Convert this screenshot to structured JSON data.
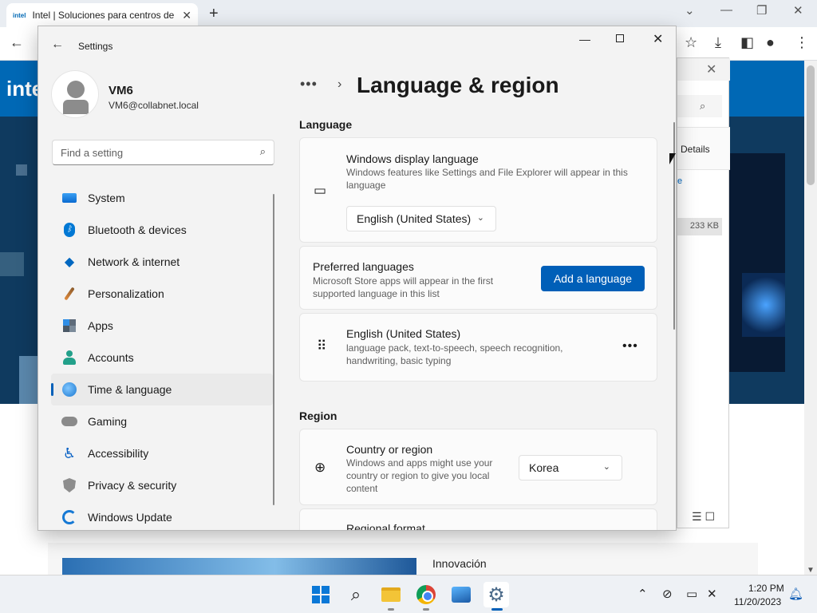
{
  "browser": {
    "tab_title": "Intel | Soluciones para centros de",
    "tab_favicon": "intel",
    "new_tab": "+",
    "intel_logo": "intel"
  },
  "page": {
    "bottom_text": "Innovación"
  },
  "explorer": {
    "details_label": "Details",
    "link_fragment": "e",
    "file_size": "233 KB"
  },
  "settings": {
    "window_title": "Settings",
    "user": {
      "name": "VM6",
      "email": "VM6@collabnet.local"
    },
    "search_placeholder": "Find a setting",
    "nav": [
      {
        "label": "System",
        "icon": "system-icon"
      },
      {
        "label": "Bluetooth & devices",
        "icon": "bluetooth-icon"
      },
      {
        "label": "Network & internet",
        "icon": "wifi-icon"
      },
      {
        "label": "Personalization",
        "icon": "brush-icon"
      },
      {
        "label": "Apps",
        "icon": "apps-icon"
      },
      {
        "label": "Accounts",
        "icon": "accounts-icon"
      },
      {
        "label": "Time & language",
        "icon": "time-language-icon",
        "selected": true
      },
      {
        "label": "Gaming",
        "icon": "gamepad-icon"
      },
      {
        "label": "Accessibility",
        "icon": "accessibility-icon"
      },
      {
        "label": "Privacy & security",
        "icon": "shield-icon"
      },
      {
        "label": "Windows Update",
        "icon": "update-icon"
      }
    ],
    "breadcrumb_more": "•••",
    "page_title": "Language & region",
    "language_section": {
      "heading": "Language",
      "display_language": {
        "title": "Windows display language",
        "description": "Windows features like Settings and File Explorer will appear in this language",
        "value": "English (United States)"
      },
      "preferred": {
        "title": "Preferred languages",
        "description": "Microsoft Store apps will appear in the first supported language in this list",
        "button": "Add a language"
      },
      "installed": {
        "title": "English (United States)",
        "description": "language pack, text-to-speech, speech recognition, handwriting, basic typing",
        "more": "•••"
      }
    },
    "region_section": {
      "heading": "Region",
      "country": {
        "title": "Country or region",
        "description": "Windows and apps might use your country or region to give you local content",
        "value": "Korea"
      },
      "format": {
        "title": "Regional format"
      }
    }
  },
  "taskbar": {
    "clock_time": "1:20 PM",
    "clock_date": "11/20/2023"
  },
  "colors": {
    "accent": "#005fb8",
    "intel_blue": "#0068b5"
  }
}
